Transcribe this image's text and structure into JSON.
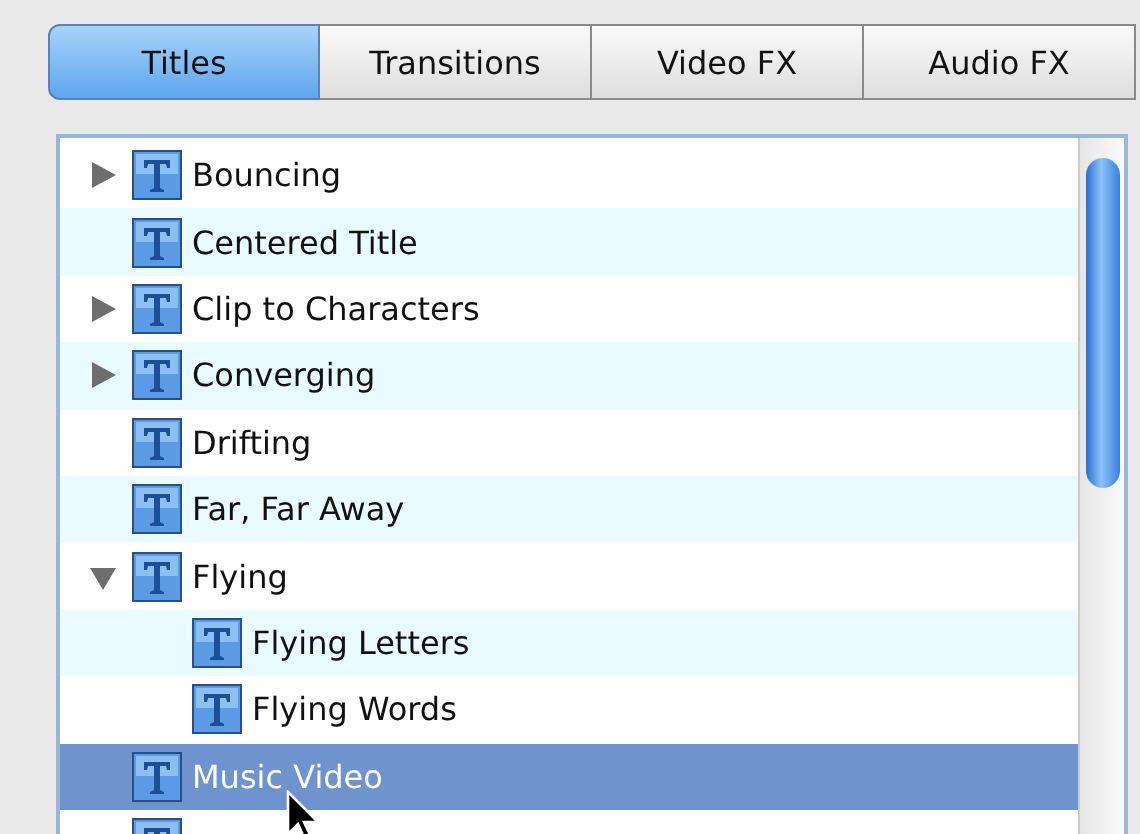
{
  "tabs": [
    {
      "label": "Titles",
      "selected": true
    },
    {
      "label": "Transitions",
      "selected": false
    },
    {
      "label": "Video FX",
      "selected": false
    },
    {
      "label": "Audio FX",
      "selected": false
    }
  ],
  "tree": [
    {
      "label": "Bouncing",
      "kind": "group",
      "expanded": false,
      "selected": false
    },
    {
      "label": "Centered Title",
      "kind": "title",
      "selected": false
    },
    {
      "label": "Clip to Characters",
      "kind": "group",
      "expanded": false,
      "selected": false
    },
    {
      "label": "Converging",
      "kind": "group",
      "expanded": false,
      "selected": false
    },
    {
      "label": "Drifting",
      "kind": "title",
      "selected": false
    },
    {
      "label": "Far, Far Away",
      "kind": "title",
      "selected": false
    },
    {
      "label": "Flying",
      "kind": "group",
      "expanded": true,
      "selected": false,
      "children": [
        {
          "label": "Flying Letters",
          "kind": "title",
          "selected": false
        },
        {
          "label": "Flying Words",
          "kind": "title",
          "selected": false
        }
      ]
    },
    {
      "label": "Music Video",
      "kind": "title",
      "selected": true
    },
    {
      "kind": "title",
      "selected": false
    }
  ]
}
